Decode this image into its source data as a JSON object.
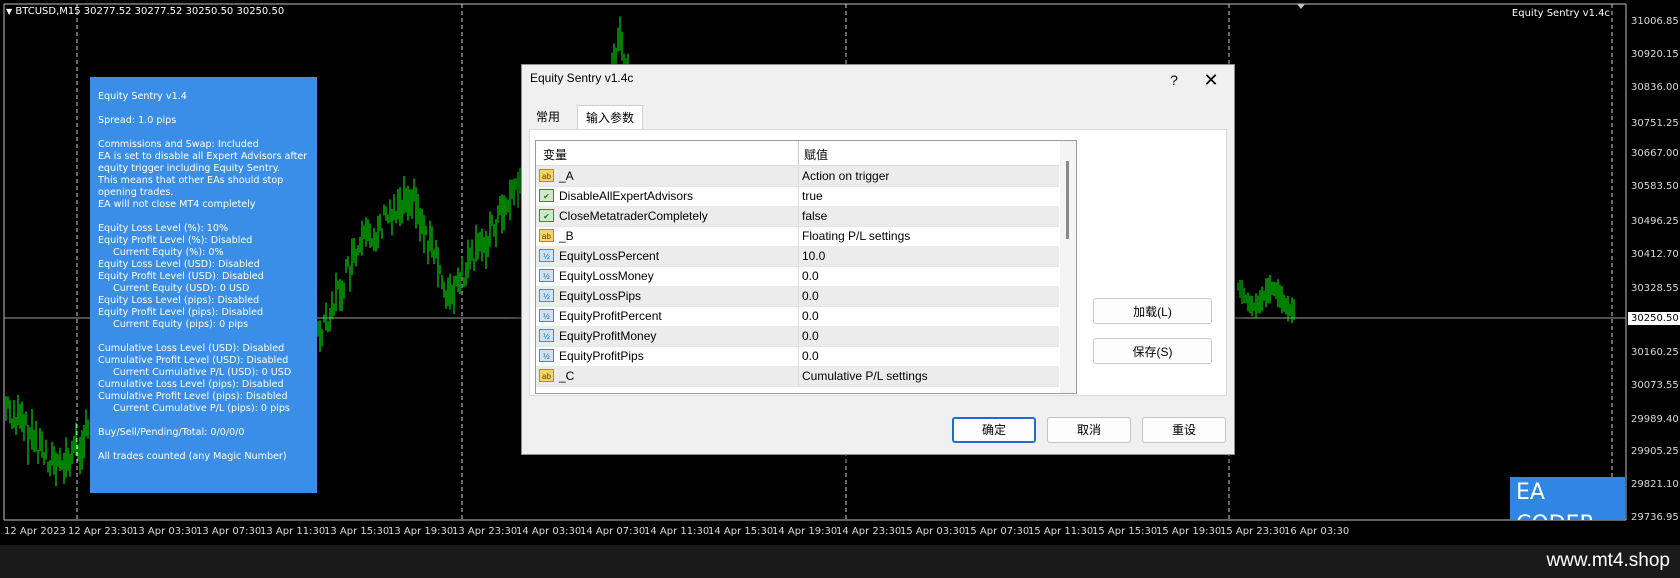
{
  "chart": {
    "header": "BTCUSD,M15  30277.52 30277.52 30250.50 30250.50",
    "ea_label": "Equity Sentry v1.4c",
    "current_price": "30250.50",
    "price_labels": [
      "31006.85",
      "30920.15",
      "30836.00",
      "30751.25",
      "30667.00",
      "30583.50",
      "30496.25",
      "30412.70",
      "30328.55",
      "30160.25",
      "30073.55",
      "29989.40",
      "29905.25",
      "29821.10",
      "29736.95"
    ],
    "time_labels": [
      "12 Apr 2023",
      "12 Apr 23:30",
      "13 Apr 03:30",
      "13 Apr 07:30",
      "13 Apr 11:30",
      "13 Apr 15:30",
      "13 Apr 19:30",
      "13 Apr 23:30",
      "14 Apr 03:30",
      "14 Apr 07:30",
      "14 Apr 11:30",
      "14 Apr 15:30",
      "14 Apr 19:30",
      "14 Apr 23:30",
      "15 Apr 03:30",
      "15 Apr 07:30",
      "15 Apr 11:30",
      "15 Apr 15:30",
      "15 Apr 19:30",
      "15 Apr 23:30",
      "16 Apr 03:30"
    ],
    "candle_color": "#00ff00",
    "background": "#000000"
  },
  "info_panel": {
    "lines": [
      {
        "text": "Equity Sentry v1.4"
      },
      {
        "text": ""
      },
      {
        "text": "Spread: 1.0 pips"
      },
      {
        "text": ""
      },
      {
        "text": "Commissions and Swap: Included"
      },
      {
        "text": "EA is set to disable all Expert Advisors after"
      },
      {
        "text": "equity trigger including Equity Sentry."
      },
      {
        "text": "This means that other EAs should stop"
      },
      {
        "text": "opening trades."
      },
      {
        "text": "EA will not close MT4 completely"
      },
      {
        "text": ""
      },
      {
        "text": "Equity Loss Level (%): 10%"
      },
      {
        "text": "Equity Profit Level (%): Disabled"
      },
      {
        "text": "Current Equity (%): 0%",
        "indent": true
      },
      {
        "text": "Equity Loss Level (USD): Disabled"
      },
      {
        "text": "Equity Profit Level (USD): Disabled"
      },
      {
        "text": "Current Equity (USD): 0 USD",
        "indent": true
      },
      {
        "text": "Equity Loss Level (pips): Disabled"
      },
      {
        "text": "Equity Profit Level (pips): Disabled"
      },
      {
        "text": "Current Equity (pips): 0 pips",
        "indent": true
      },
      {
        "text": ""
      },
      {
        "text": "Cumulative Loss Level (USD): Disabled"
      },
      {
        "text": "Cumulative Profit Level (USD): Disabled"
      },
      {
        "text": "Current Cumulative P/L (USD): 0 USD",
        "indent": true
      },
      {
        "text": "Cumulative Loss Level (pips): Disabled"
      },
      {
        "text": "Cumulative Profit Level (pips): Disabled"
      },
      {
        "text": "Current Cumulative P/L (pips): 0 pips",
        "indent": true
      },
      {
        "text": ""
      },
      {
        "text": "Buy/Sell/Pending/Total: 0/0/0/0"
      },
      {
        "text": ""
      },
      {
        "text": "All trades counted (any Magic Number)"
      }
    ],
    "bg_color": "#3b8ee8"
  },
  "dialog": {
    "title": "Equity Sentry v1.4c",
    "help": "?",
    "close": "✕",
    "tabs": [
      "常用",
      "输入参数"
    ],
    "active_tab": "输入参数",
    "columns": {
      "variable": "变量",
      "value": "赋值"
    },
    "rows": [
      {
        "icon": "ab",
        "name": "_A",
        "value": "Action on trigger"
      },
      {
        "icon": "bool",
        "name": "DisableAllExpertAdvisors",
        "value": "true"
      },
      {
        "icon": "bool",
        "name": "CloseMetatraderCompletely",
        "value": "false"
      },
      {
        "icon": "ab",
        "name": "_B",
        "value": "Floating P/L settings"
      },
      {
        "icon": "num",
        "name": "EquityLossPercent",
        "value": "10.0"
      },
      {
        "icon": "num",
        "name": "EquityLossMoney",
        "value": "0.0"
      },
      {
        "icon": "num",
        "name": "EquityLossPips",
        "value": "0.0"
      },
      {
        "icon": "num",
        "name": "EquityProfitPercent",
        "value": "0.0"
      },
      {
        "icon": "num",
        "name": "EquityProfitMoney",
        "value": "0.0"
      },
      {
        "icon": "num",
        "name": "EquityProfitPips",
        "value": "0.0"
      },
      {
        "icon": "ab",
        "name": "_C",
        "value": "Cumulative P/L settings"
      }
    ],
    "load_button": "加载(L)",
    "save_button": "保存(S)",
    "ok_button": "确定",
    "cancel_button": "取消",
    "reset_button": "重设"
  },
  "logo": {
    "text": "EA CODER"
  },
  "footer": {
    "url": "www.mt4.shop"
  }
}
